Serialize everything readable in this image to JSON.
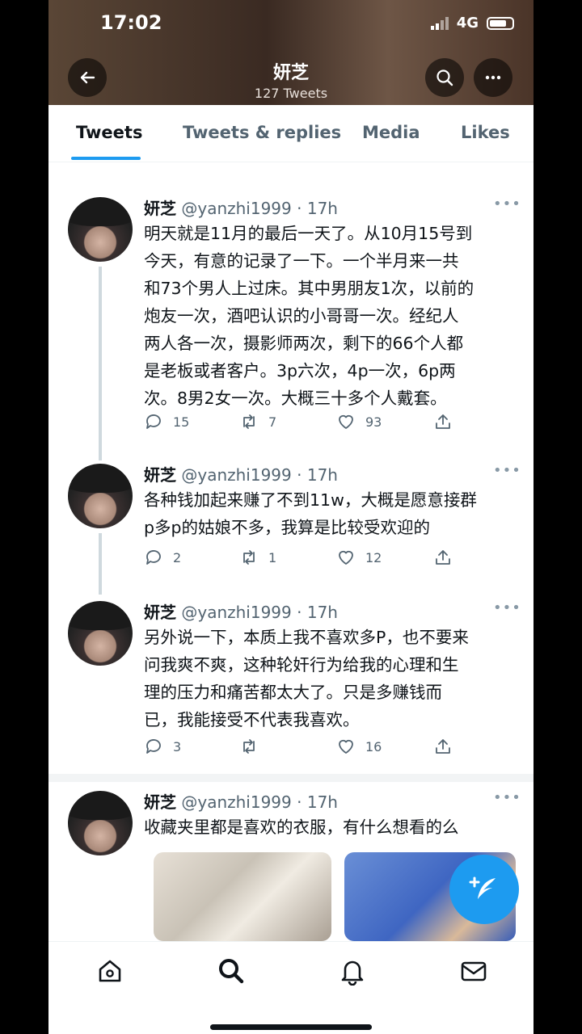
{
  "status": {
    "time": "17:02",
    "network": "4G"
  },
  "header": {
    "name": "妍芝",
    "count": "127 Tweets"
  },
  "tabs": [
    "Tweets",
    "Tweets & replies",
    "Media",
    "Likes"
  ],
  "tweets": [
    {
      "name": "妍芝",
      "handle": "@yanzhi1999",
      "time": "· 17h",
      "lines": [
        "明天就是11月的最后一天了。从10月15号到",
        "今天，有意的记录了一下。一个半月来一共",
        "和73个男人上过床。其中男朋友1次，以前的",
        "炮友一次，酒吧认识的小哥哥一次。经纪人",
        "两人各一次，摄影师两次，剩下的66个人都",
        "是老板或者客户。3p六次，4p一次，6p两",
        "次。8男2女一次。大概三十多个人戴套。"
      ],
      "replies": "15",
      "retweets": "7",
      "likes": "93"
    },
    {
      "name": "妍芝",
      "handle": "@yanzhi1999",
      "time": "· 17h",
      "lines": [
        "各种钱加起来赚了不到11w，大概是愿意接群",
        "p多p的姑娘不多，我算是比较受欢迎的"
      ],
      "replies": "2",
      "retweets": "1",
      "likes": "12"
    },
    {
      "name": "妍芝",
      "handle": "@yanzhi1999",
      "time": "· 17h",
      "lines": [
        "另外说一下，本质上我不喜欢多P，也不要来",
        "问我爽不爽，这种轮奸行为给我的心理和生",
        "理的压力和痛苦都太大了。只是多赚钱而",
        "已，我能接受不代表我喜欢。"
      ],
      "replies": "3",
      "retweets": "",
      "likes": "16"
    },
    {
      "name": "妍芝",
      "handle": "@yanzhi1999",
      "time": "· 17h",
      "lines": [
        "收藏夹里都是喜欢的衣服，有什么想看的么"
      ]
    }
  ],
  "colors": {
    "accent": "#1d9bf0",
    "text": "#0f1419",
    "muted": "#536471"
  }
}
